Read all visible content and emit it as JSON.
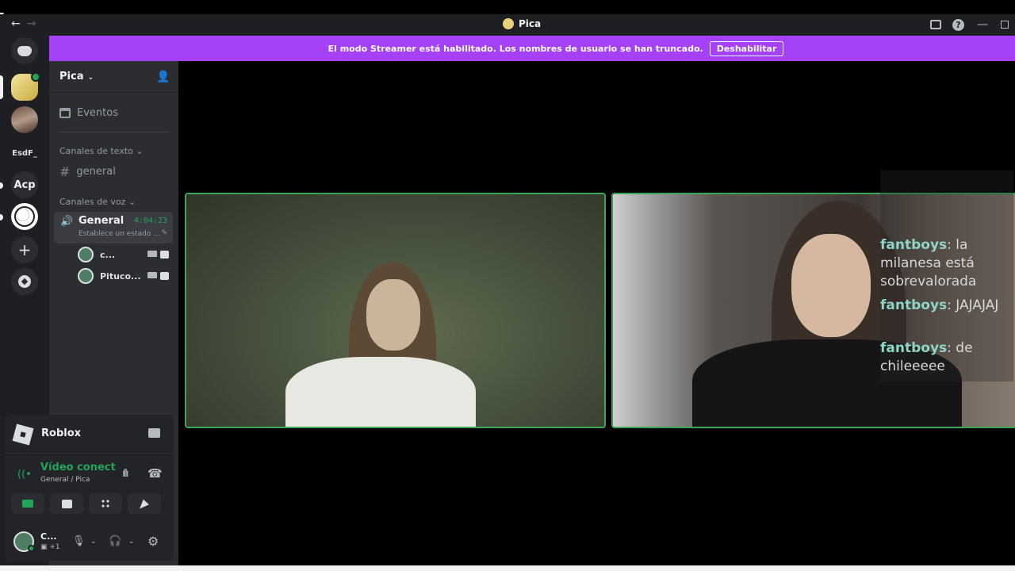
{
  "window": {
    "title": "Pica",
    "nav_back": "←",
    "nav_forward": "→"
  },
  "banner": {
    "message": "El modo Streamer está habilitado. Los nombres de usuario se han truncado.",
    "button_label": "Deshabilitar",
    "color": "#a541f8"
  },
  "rail": {
    "servers": [
      {
        "label": "",
        "icon": "discord-logo-icon"
      },
      {
        "label": "",
        "icon": "pica-server-icon"
      },
      {
        "label": "",
        "icon": "server-avatar-icon"
      },
      {
        "label": "EsdF_"
      },
      {
        "label": "Acp"
      },
      {
        "label": "",
        "icon": "ball-server-icon"
      }
    ],
    "add_label": "+"
  },
  "guild": {
    "name": "Pica",
    "events_label": "Eventos",
    "text_category": "Canales de texto",
    "text_channel": "general",
    "voice_category": "Canales de voz",
    "voice_channel": {
      "name": "General",
      "timer": "4:04:23",
      "status": "Establece un estado ..."
    },
    "voice_users": [
      {
        "name": "c..."
      },
      {
        "name": "Pitucо..."
      }
    ]
  },
  "activity": {
    "name": "Roblox"
  },
  "voice_connection": {
    "title": "Vídeo conectado",
    "subtitle": "General / Pica"
  },
  "user": {
    "name": "C...",
    "sub": "+1"
  },
  "chat_overlay": {
    "messages": [
      {
        "user": "fantboys",
        "text": ": la milanesa está sobrevalorada"
      },
      {
        "user": "fantboys",
        "text": ": JAJAJAJ"
      },
      {
        "user": "fantboys",
        "text": ": de chileeeee"
      }
    ]
  },
  "colors": {
    "accent_green": "#23a559",
    "tile_border": "#3ba55c",
    "chat_user": "#8fd4c4"
  }
}
